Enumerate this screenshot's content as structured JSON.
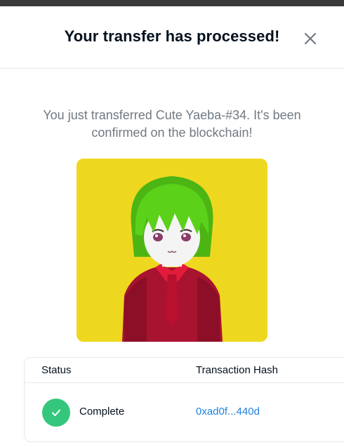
{
  "modal": {
    "title": "Your transfer has processed!",
    "close_icon": "close-icon",
    "message": "You just transferred Cute Yaeba-#34. It's been confirmed on the blockchain!",
    "nft_image": {
      "background_color": "#eed81f",
      "hair_color": "#5bd11a"
    }
  },
  "table": {
    "headers": [
      "Status",
      "Transaction Hash"
    ],
    "row": {
      "status_icon": "checkmark-icon",
      "status": "Complete",
      "hash": "0xad0f...440d"
    }
  },
  "colors": {
    "title": "#04111d",
    "muted_text": "#707a83",
    "success": "#34c77b",
    "link": "#2081e2",
    "border": "#e5e8eb"
  }
}
